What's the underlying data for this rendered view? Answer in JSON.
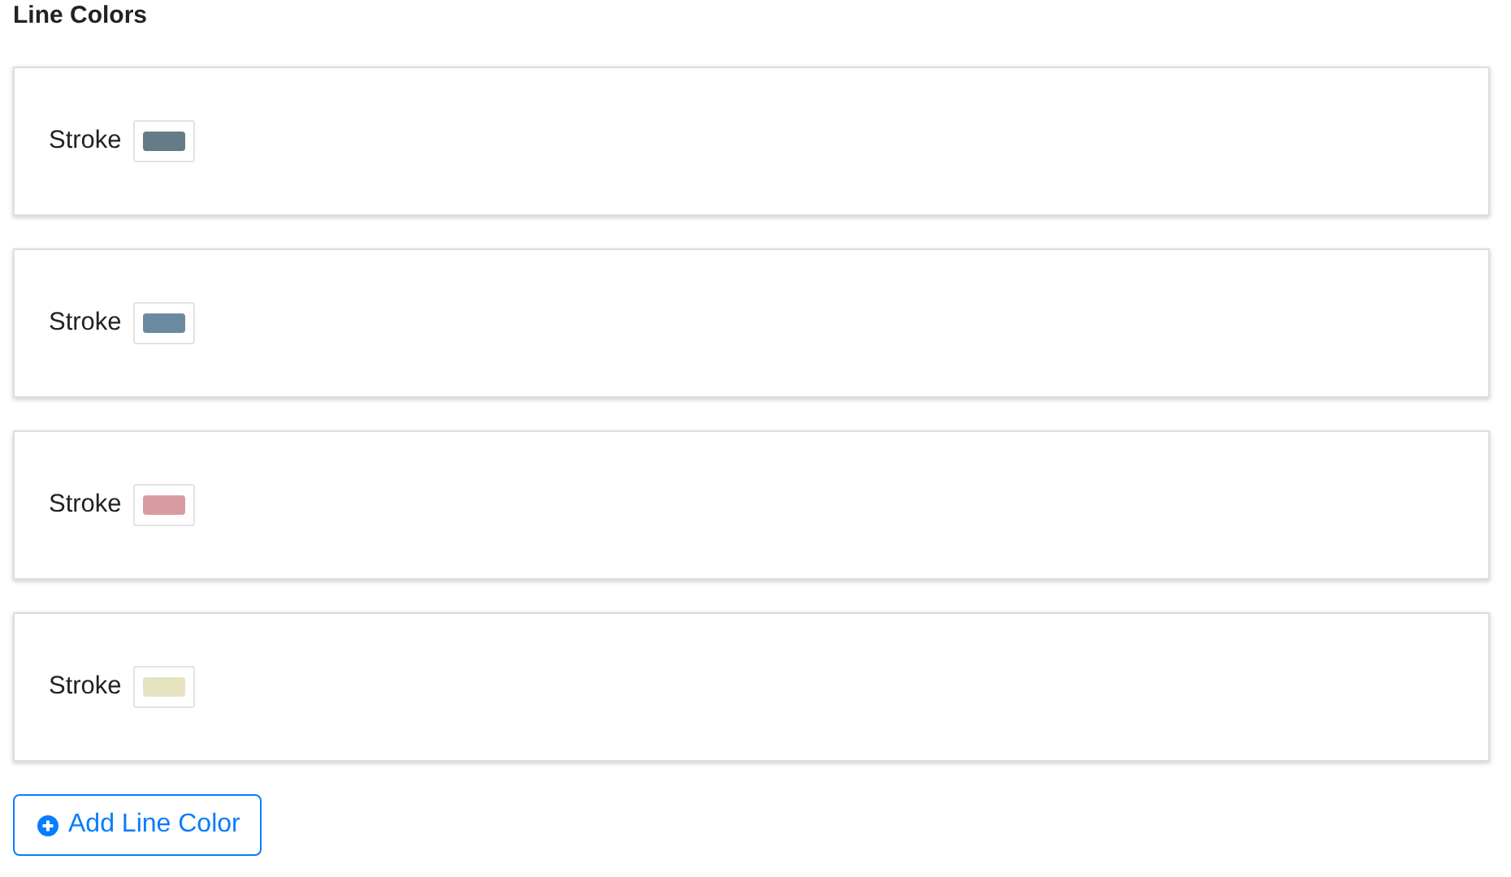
{
  "title": "Line Colors",
  "line_colors": [
    {
      "label": "Stroke",
      "color": "#657b87"
    },
    {
      "label": "Stroke",
      "color": "#6a8aa0"
    },
    {
      "label": "Stroke",
      "color": "#d89ca0"
    },
    {
      "label": "Stroke",
      "color": "#e6e3c0"
    }
  ],
  "add_button": {
    "label": "Add Line Color"
  }
}
